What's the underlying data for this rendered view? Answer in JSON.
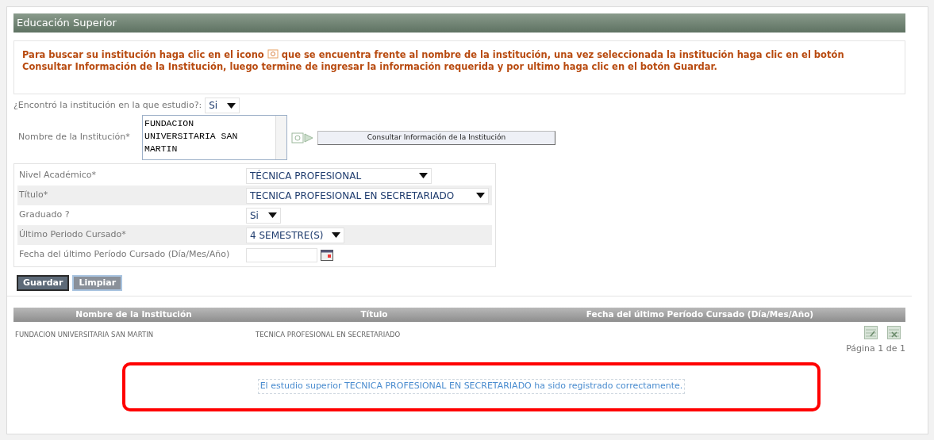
{
  "section_title": "Educación Superior",
  "instructions": {
    "before": "Para buscar su institución haga clic en el icono",
    "after": "que se encuentra frente al nombre de la institución, una vez seleccionada la institución haga clic en el botón Consultar Información de la Institución, luego termine de ingresar la información requerida y por ultimo haga clic en el botón Guardar."
  },
  "found_question": {
    "label": "¿Encontró la institución en la que estudio?:",
    "value": "Si"
  },
  "institution": {
    "label": "Nombre de la Institución*",
    "value": "FUNDACION\nUNIVERSITARIA SAN\nMARTIN",
    "button": "Consultar Información de la Institución"
  },
  "fields": [
    {
      "kind": "select",
      "label": "Nivel Académico*",
      "value": "TÉCNICA PROFESIONAL"
    },
    {
      "kind": "select",
      "label": "Título*",
      "value": "TECNICA PROFESIONAL EN SECRETARIADO"
    },
    {
      "kind": "select",
      "label": "Graduado ?",
      "value": "Si"
    },
    {
      "kind": "select",
      "label": "Último Periodo Cursado*",
      "value": "4 SEMESTRE(S)"
    },
    {
      "kind": "date",
      "label": "Fecha del último Período Cursado (Día/Mes/Año)"
    }
  ],
  "buttons": [
    "Guardar",
    "Limpiar"
  ],
  "table": {
    "columns": [
      "Nombre de la Institución",
      "Título",
      "Fecha del último Período Cursado (Día/Mes/Año)"
    ],
    "rows": [
      [
        "FUNDACION UNIVERSITARIA SAN MARTIN",
        "TECNICA PROFESIONAL EN SECRETARIADO"
      ]
    ],
    "pagination": "Página 1 de 1"
  },
  "message": "El estudio superior TECNICA PROFESIONAL EN SECRETARIADO ha sido registrado correctamente."
}
